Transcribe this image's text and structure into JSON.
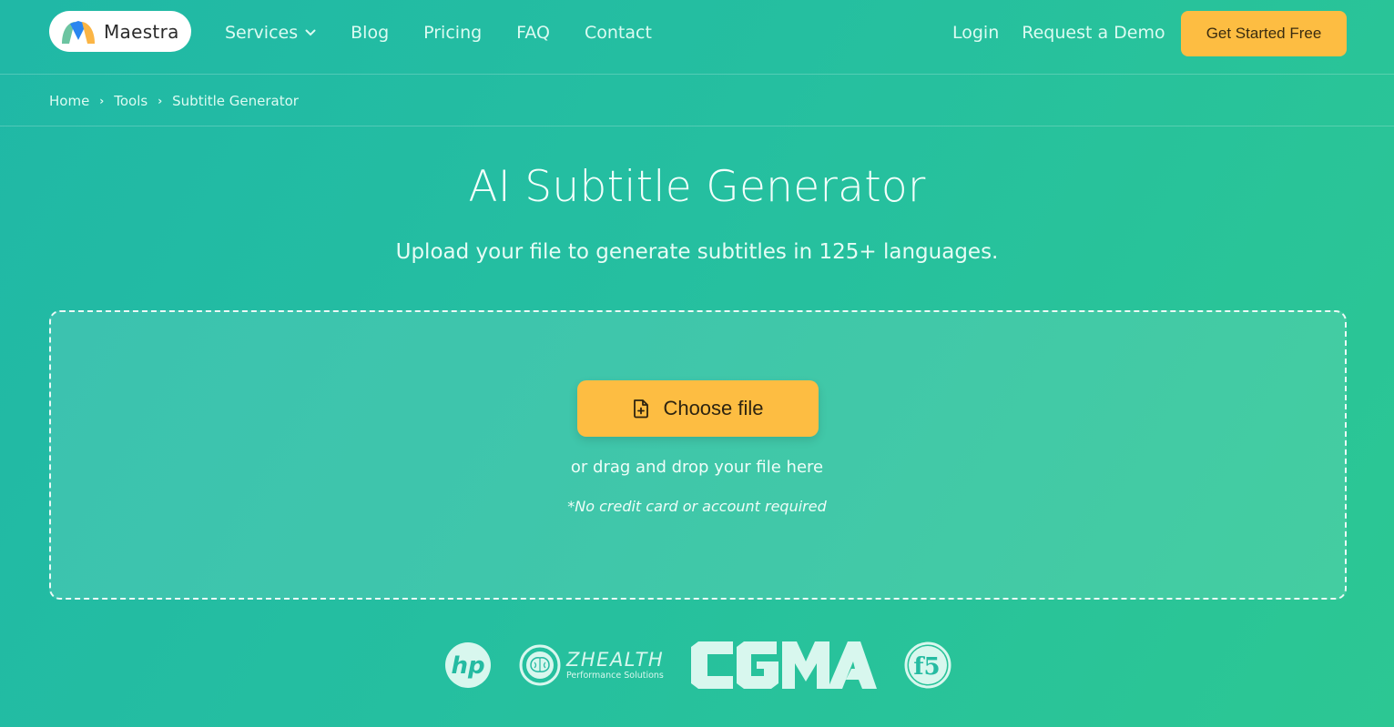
{
  "header": {
    "logo": {
      "name": "Maestra",
      "icon": "maestra-logo-icon"
    },
    "nav_left": [
      {
        "label": "Services",
        "has_dropdown": true
      },
      {
        "label": "Blog"
      },
      {
        "label": "Pricing"
      },
      {
        "label": "FAQ"
      },
      {
        "label": "Contact"
      }
    ],
    "nav_right": [
      {
        "label": "Login"
      },
      {
        "label": "Request a Demo"
      }
    ],
    "cta_label": "Get Started Free"
  },
  "breadcrumb": [
    {
      "label": "Home"
    },
    {
      "label": "Tools"
    },
    {
      "label": "Subtitle Generator"
    }
  ],
  "hero": {
    "title": "AI Subtitle Generator",
    "subtitle": "Upload your file to generate subtitles in 125+ languages."
  },
  "upload": {
    "button_label": "Choose file",
    "button_icon": "file-plus-icon",
    "drag_text": "or drag and drop your file here",
    "note": "*No credit card or account required"
  },
  "client_logos": [
    {
      "name": "hp",
      "label": "hp"
    },
    {
      "name": "zhealth",
      "label": "ZHEALTH",
      "sublabel": "Performance Solutions"
    },
    {
      "name": "cgma",
      "label": "CGMA"
    },
    {
      "name": "f5",
      "label": "f5"
    }
  ],
  "colors": {
    "background_start": "#20b8a6",
    "background_end": "#2cc793",
    "accent_button": "#fdbd42",
    "nav_text": "#dcfbf2"
  }
}
